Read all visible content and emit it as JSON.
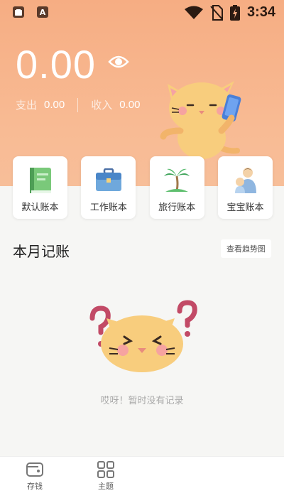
{
  "status_bar": {
    "time": "3:34",
    "left_icons": [
      "notification-icon",
      "keyboard-a-icon"
    ],
    "right_icons": [
      "wifi-icon",
      "no-sim-icon",
      "battery-charging-icon"
    ],
    "keyboard_glyph": "A"
  },
  "overview": {
    "balance": "0.00",
    "expense_label": "支出",
    "expense_value": "0.00",
    "income_label": "收入",
    "income_value": "0.00"
  },
  "accounts": [
    {
      "label": "默认账本",
      "icon": "green-book-icon"
    },
    {
      "label": "工作账本",
      "icon": "briefcase-icon"
    },
    {
      "label": "旅行账本",
      "icon": "palm-tree-icon"
    },
    {
      "label": "宝宝账本",
      "icon": "baby-family-icon"
    }
  ],
  "monthly": {
    "title": "本月记账",
    "trend_button": "查看趋势图",
    "empty_text": "哎呀！暂时没有记录"
  },
  "bottom_nav": [
    {
      "label": "存钱",
      "icon": "wallet-icon"
    },
    {
      "label": "主题",
      "icon": "grid-icon"
    }
  ],
  "colors": {
    "header_gradient_top": "#f6ad83",
    "header_gradient_bottom": "#f7be99",
    "accent_orange": "#f4a46f",
    "background": "#f6f6f4"
  }
}
